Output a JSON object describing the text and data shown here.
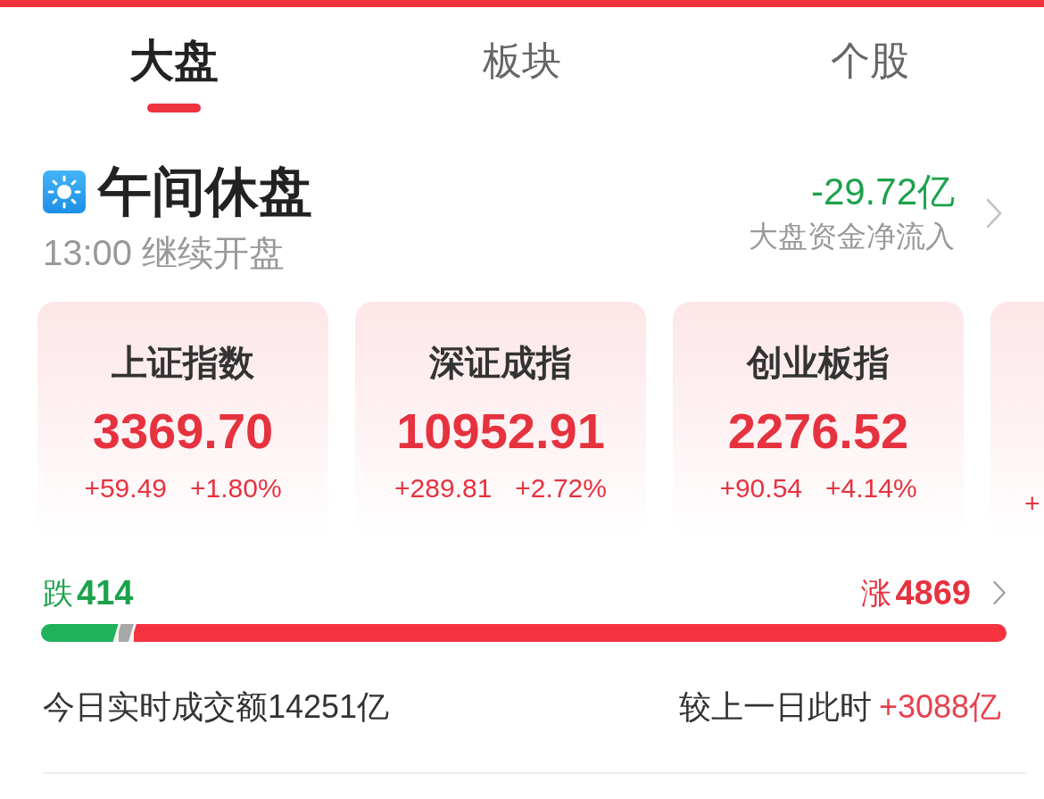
{
  "tabs": [
    {
      "label": "大盘",
      "selected": true
    },
    {
      "label": "板块",
      "selected": false
    },
    {
      "label": "个股",
      "selected": false
    }
  ],
  "status": {
    "title": "午间休盘",
    "subtitle": "13:00 继续开盘",
    "net_flow": "-29.72亿",
    "net_flow_label": "大盘资金净流入"
  },
  "indices": [
    {
      "name": "上证指数",
      "value": "3369.70",
      "change": "+59.49",
      "change_pct": "+1.80%"
    },
    {
      "name": "深证成指",
      "value": "10952.91",
      "change": "+289.81",
      "change_pct": "+2.72%"
    },
    {
      "name": "创业板指",
      "value": "2276.52",
      "change": "+90.54",
      "change_pct": "+4.14%"
    },
    {
      "change": "+"
    }
  ],
  "breadth": {
    "down_label": "跌",
    "down_count": "414",
    "up_label": "涨",
    "up_count": "4869",
    "segments": [
      {
        "color": "#20b15a",
        "level": 0.08
      },
      {
        "color": "#a8a8a8",
        "level": 0.016
      },
      {
        "color": "#f5333f",
        "level": 0.904
      }
    ]
  },
  "turnover": {
    "label": "今日实时成交额14251亿",
    "compare_label": "较上一日此时",
    "compare_value": "+3088亿"
  }
}
